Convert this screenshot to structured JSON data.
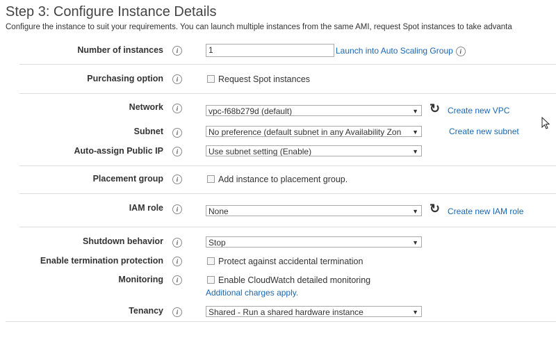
{
  "page": {
    "title": "Step 3: Configure Instance Details",
    "subtitle": "Configure the instance to suit your requirements. You can launch multiple instances from the same AMI, request Spot instances to take advanta"
  },
  "form": {
    "number_of_instances": {
      "label": "Number of instances",
      "value": "1",
      "link": "Launch into Auto Scaling Group"
    },
    "purchasing_option": {
      "label": "Purchasing option",
      "checkbox": "Request Spot instances",
      "checked": false
    },
    "network": {
      "label": "Network",
      "value": "vpc-f68b279d (default)",
      "link": "Create new VPC"
    },
    "subnet": {
      "label": "Subnet",
      "value": "No preference (default subnet in any Availability Zon",
      "link": "Create new subnet"
    },
    "auto_assign_ip": {
      "label": "Auto-assign Public IP",
      "value": "Use subnet setting (Enable)"
    },
    "placement_group": {
      "label": "Placement group",
      "checkbox": "Add instance to placement group.",
      "checked": false
    },
    "iam_role": {
      "label": "IAM role",
      "value": "None",
      "link": "Create new IAM role"
    },
    "shutdown_behavior": {
      "label": "Shutdown behavior",
      "value": "Stop"
    },
    "termination_protection": {
      "label": "Enable termination protection",
      "checkbox": "Protect against accidental termination",
      "checked": false
    },
    "monitoring": {
      "label": "Monitoring",
      "checkbox": "Enable CloudWatch detailed monitoring",
      "checked": false,
      "note": "Additional charges apply."
    },
    "tenancy": {
      "label": "Tenancy",
      "value": "Shared - Run a shared hardware instance"
    }
  },
  "icons": {
    "info": "info-icon",
    "refresh": "refresh-icon",
    "dropdown": "chevron-down-icon",
    "cursor": "mouse-cursor-icon"
  },
  "colors": {
    "link": "#1a66b0",
    "divider": "#dcdcdc",
    "text": "#333333"
  }
}
